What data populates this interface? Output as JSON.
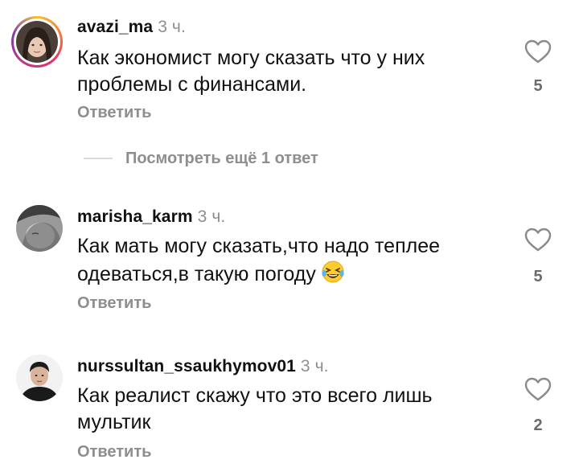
{
  "comments": [
    {
      "username": "avazi_ma",
      "time": "3 ч.",
      "text_line1": "Как экономист могу сказать что у них",
      "text_line2": "проблемы с финансами.",
      "likes": "5",
      "reply_label": "Ответить"
    },
    {
      "username": "marisha_karm",
      "time": "3 ч.",
      "text_line1": "Как мать могу сказать,что надо теплее",
      "text_line2": "одеваться,в такую погоду",
      "likes": "5",
      "reply_label": "Ответить"
    },
    {
      "username": "nurssultan_ssaukhymov01",
      "time": "3 ч.",
      "text_line1": "Как реалист скажу что это всего лишь",
      "text_line2": "мультик",
      "likes": "2",
      "reply_label": "Ответить"
    }
  ],
  "view_more_replies": "Посмотреть ещё 1 ответ",
  "icons": {
    "like": "heart-outline-icon",
    "emoji": "laughing-with-tears-emoji"
  },
  "colors": {
    "secondary_text": "#8e8e8e",
    "primary_text": "#111111"
  }
}
